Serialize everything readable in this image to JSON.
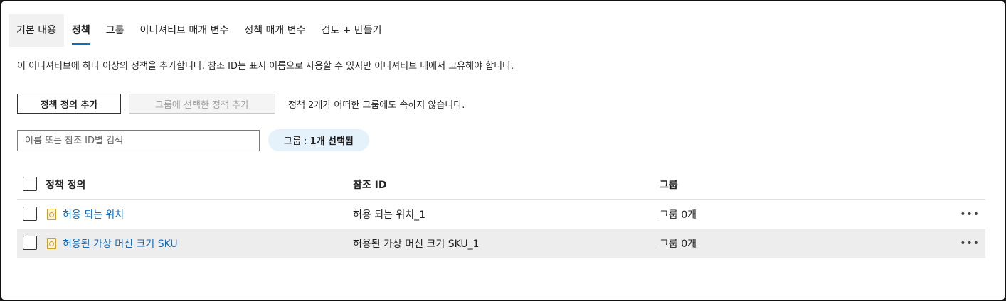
{
  "tabs": [
    {
      "label": "기본 내용"
    },
    {
      "label": "정책"
    },
    {
      "label": "그룹"
    },
    {
      "label": "이니셔티브 매개 변수"
    },
    {
      "label": "정책 매개 변수"
    },
    {
      "label": "검토 + 만들기"
    }
  ],
  "active_tab": "정책",
  "description": "이 이니셔티브에 하나 이상의 정책을 추가합니다. 참조 ID는 표시 이름으로 사용할 수 있지만 이니셔티브 내에서 고유해야 합니다.",
  "toolbar": {
    "add_policy_label": "정책 정의 추가",
    "add_to_group_label": "그룹에 선택한 정책 추가",
    "note": "정책 2개가 어떠한 그룹에도 속하지 않습니다."
  },
  "search": {
    "placeholder": "이름 또는 참조 ID별 검색"
  },
  "filter": {
    "label": "그룹 :",
    "value": "1개 선택됨"
  },
  "table": {
    "headers": {
      "policy": "정책 정의",
      "ref_id": "참조 ID",
      "group": "그룹"
    },
    "rows": [
      {
        "policy": "허용 되는 위치",
        "ref_id": "허용 되는 위치_1",
        "group": "그룹 0개",
        "more": "•••"
      },
      {
        "policy": "허용된 가상 머신 크기 SKU",
        "ref_id": "허용된 가상 머신 크기 SKU_1",
        "group": "그룹 0개",
        "more": "•••"
      }
    ]
  },
  "colors": {
    "accent": "#0f6cbd",
    "pill_bg": "#e5f1fb",
    "selected_row": "#ededed"
  }
}
